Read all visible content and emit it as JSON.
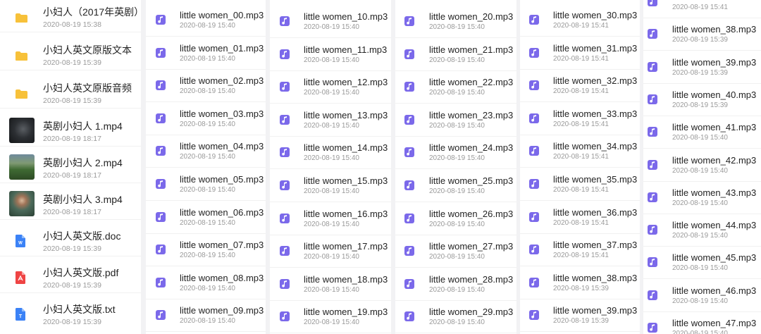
{
  "panel0": {
    "items": [
      {
        "name": "小妇人（2017年英剧）",
        "date": "2020-08-19 15:38",
        "icon": "folder-icon"
      },
      {
        "name": "小妇人英文原版文本",
        "date": "2020-08-19 15:39",
        "icon": "folder-icon"
      },
      {
        "name": "小妇人英文原版音频",
        "date": "2020-08-19 15:39",
        "icon": "folder-icon"
      },
      {
        "name": "英剧小妇人 1.mp4",
        "date": "2020-08-19 18:17",
        "icon": "video-thumbnail"
      },
      {
        "name": "英剧小妇人 2.mp4",
        "date": "2020-08-19 18:17",
        "icon": "video-thumbnail"
      },
      {
        "name": "英剧小妇人 3.mp4",
        "date": "2020-08-19 18:17",
        "icon": "video-thumbnail"
      },
      {
        "name": "小妇人英文版.doc",
        "date": "2020-08-19 15:39",
        "icon": "word-doc-icon"
      },
      {
        "name": "小妇人英文版.pdf",
        "date": "2020-08-19 15:39",
        "icon": "pdf-icon"
      },
      {
        "name": "小妇人英文版.txt",
        "date": "2020-08-19 15:39",
        "icon": "txt-icon"
      }
    ]
  },
  "panel1": {
    "items": [
      {
        "name": "little women_00.mp3",
        "date": "2020-08-19 15:40"
      },
      {
        "name": "little women_01.mp3",
        "date": "2020-08-19 15:40"
      },
      {
        "name": "little women_02.mp3",
        "date": "2020-08-19 15:40"
      },
      {
        "name": "little women_03.mp3",
        "date": "2020-08-19 15:40"
      },
      {
        "name": "little women_04.mp3",
        "date": "2020-08-19 15:40"
      },
      {
        "name": "little women_05.mp3",
        "date": "2020-08-19 15:40"
      },
      {
        "name": "little women_06.mp3",
        "date": "2020-08-19 15:40"
      },
      {
        "name": "little women_07.mp3",
        "date": "2020-08-19 15:40"
      },
      {
        "name": "little women_08.mp3",
        "date": "2020-08-19 15:40"
      },
      {
        "name": "little women_09.mp3",
        "date": "2020-08-19 15:40"
      }
    ]
  },
  "panel2": {
    "items": [
      {
        "name": "little women_10.mp3",
        "date": "2020-08-19 15:40"
      },
      {
        "name": "little women_11.mp3",
        "date": "2020-08-19 15:40"
      },
      {
        "name": "little women_12.mp3",
        "date": "2020-08-19 15:40"
      },
      {
        "name": "little women_13.mp3",
        "date": "2020-08-19 15:40"
      },
      {
        "name": "little women_14.mp3",
        "date": "2020-08-19 15:40"
      },
      {
        "name": "little women_15.mp3",
        "date": "2020-08-19 15:40"
      },
      {
        "name": "little women_16.mp3",
        "date": "2020-08-19 15:40"
      },
      {
        "name": "little women_17.mp3",
        "date": "2020-08-19 15:40"
      },
      {
        "name": "little women_18.mp3",
        "date": "2020-08-19 15:40"
      },
      {
        "name": "little women_19.mp3",
        "date": "2020-08-19 15:40"
      }
    ]
  },
  "panel3": {
    "items": [
      {
        "name": "little women_20.mp3",
        "date": "2020-08-19 15:40"
      },
      {
        "name": "little women_21.mp3",
        "date": "2020-08-19 15:40"
      },
      {
        "name": "little women_22.mp3",
        "date": "2020-08-19 15:40"
      },
      {
        "name": "little women_23.mp3",
        "date": "2020-08-19 15:40"
      },
      {
        "name": "little women_24.mp3",
        "date": "2020-08-19 15:40"
      },
      {
        "name": "little women_25.mp3",
        "date": "2020-08-19 15:40"
      },
      {
        "name": "little women_26.mp3",
        "date": "2020-08-19 15:40"
      },
      {
        "name": "little women_27.mp3",
        "date": "2020-08-19 15:40"
      },
      {
        "name": "little women_28.mp3",
        "date": "2020-08-19 15:40"
      },
      {
        "name": "little women_29.mp3",
        "date": "2020-08-19 15:40"
      }
    ]
  },
  "panel4": {
    "items": [
      {
        "name": "little women_30.mp3",
        "date": "2020-08-19 15:41"
      },
      {
        "name": "little women_31.mp3",
        "date": "2020-08-19 15:41"
      },
      {
        "name": "little women_32.mp3",
        "date": "2020-08-19 15:41"
      },
      {
        "name": "little women_33.mp3",
        "date": "2020-08-19 15:41"
      },
      {
        "name": "little women_34.mp3",
        "date": "2020-08-19 15:41"
      },
      {
        "name": "little women_35.mp3",
        "date": "2020-08-19 15:41"
      },
      {
        "name": "little women_36.mp3",
        "date": "2020-08-19 15:41"
      },
      {
        "name": "little women_37.mp3",
        "date": "2020-08-19 15:41"
      },
      {
        "name": "little women_38.mp3",
        "date": "2020-08-19 15:39"
      },
      {
        "name": "little women_39.mp3",
        "date": "2020-08-19 15:39"
      }
    ]
  },
  "panel5": {
    "items": [
      {
        "name": "",
        "date": "2020-08-19 15:41"
      },
      {
        "name": "little women_38.mp3",
        "date": "2020-08-19 15:39"
      },
      {
        "name": "little women_39.mp3",
        "date": "2020-08-19 15:39"
      },
      {
        "name": "little women_40.mp3",
        "date": "2020-08-19 15:39"
      },
      {
        "name": "little women_41.mp3",
        "date": "2020-08-19 15:40"
      },
      {
        "name": "little women_42.mp3",
        "date": "2020-08-19 15:40"
      },
      {
        "name": "little women_43.mp3",
        "date": "2020-08-19 15:40"
      },
      {
        "name": "little women_44.mp3",
        "date": "2020-08-19 15:40"
      },
      {
        "name": "little women_45.mp3",
        "date": "2020-08-19 15:40"
      },
      {
        "name": "little women_46.mp3",
        "date": "2020-08-19 15:40"
      },
      {
        "name": "little women_47.mp3",
        "date": "2020-08-19 15:40"
      }
    ]
  },
  "colors": {
    "music_icon": "#7b69ea",
    "folder": "#f7c13a",
    "word": "#3b82f6",
    "pdf": "#ef4444",
    "txt": "#3b82f6"
  }
}
